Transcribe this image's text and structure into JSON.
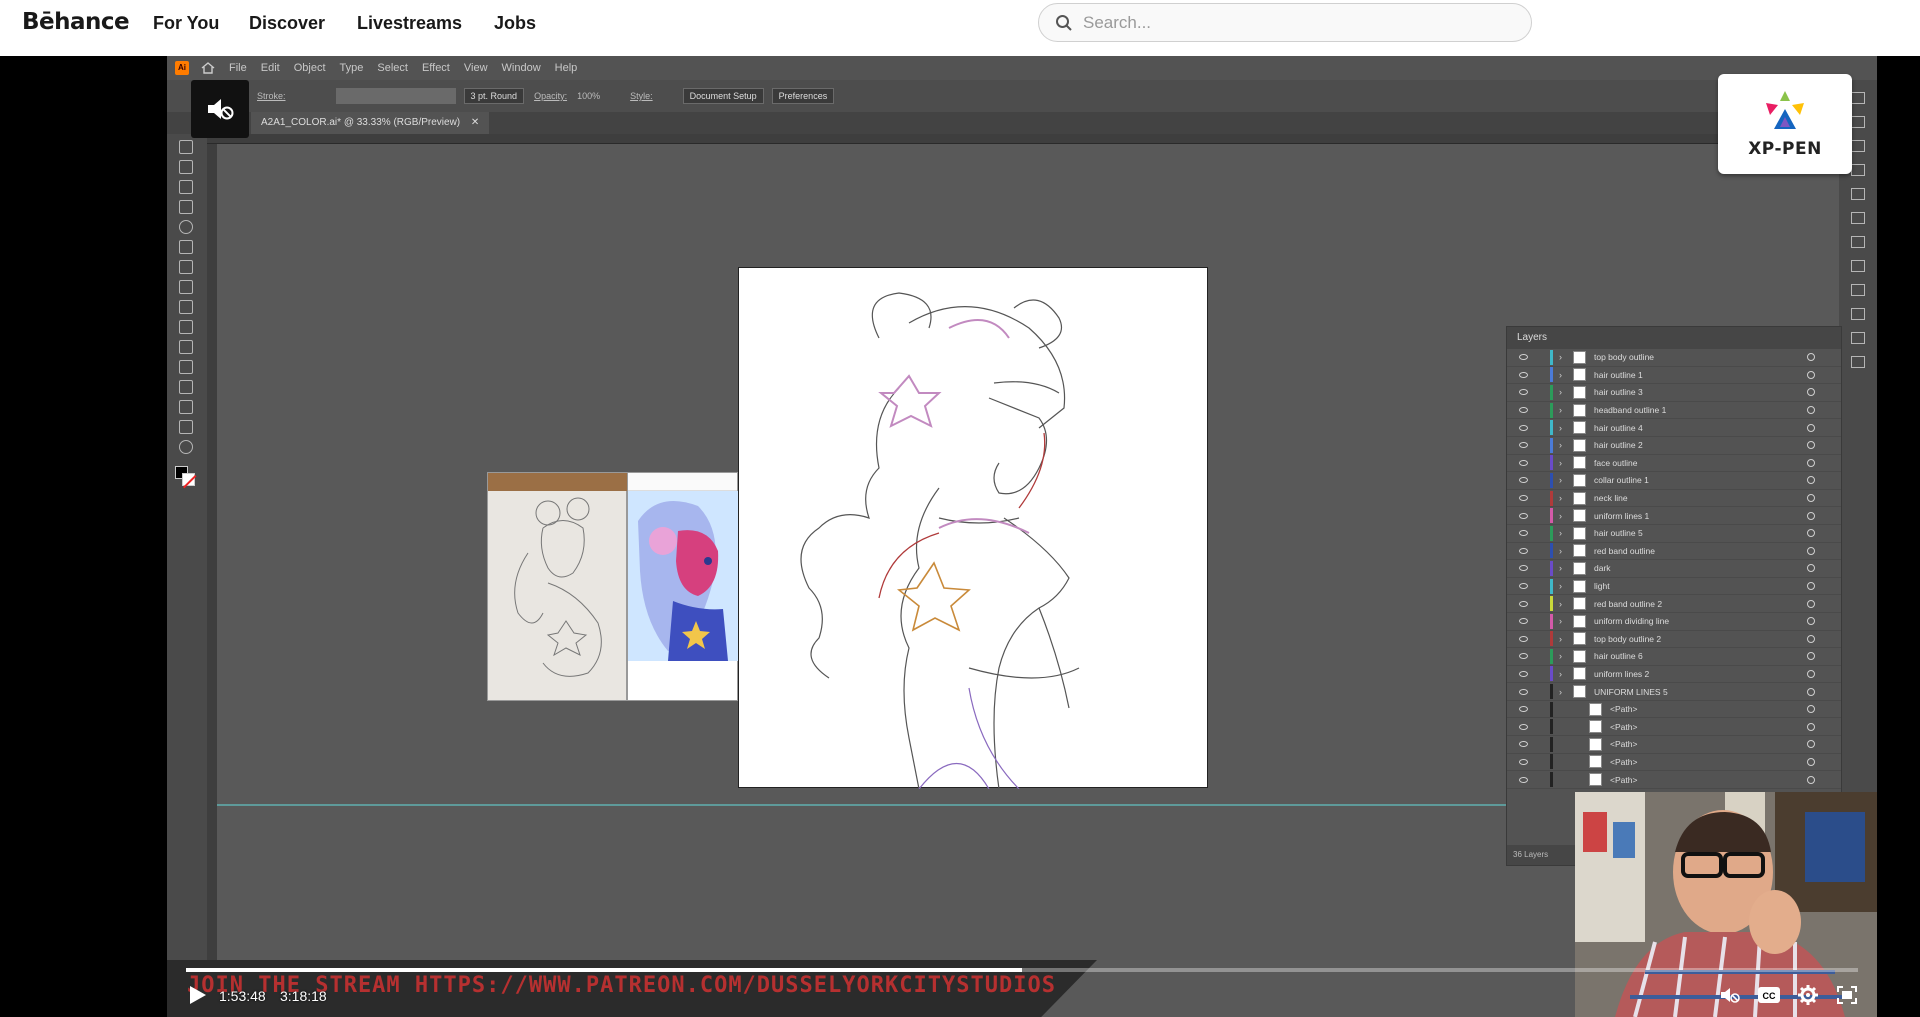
{
  "nav": {
    "logo": "Bēhance",
    "links": [
      "For You",
      "Discover",
      "Livestreams",
      "Jobs"
    ],
    "search_placeholder": "Search..."
  },
  "illustrator": {
    "menu": [
      "File",
      "Edit",
      "Object",
      "Type",
      "Select",
      "Effect",
      "View",
      "Window",
      "Help"
    ],
    "control_bar": {
      "stroke_label": "Stroke:",
      "brush": "3 pt. Round",
      "opacity_label": "Opacity:",
      "opacity_value": "100%",
      "style_label": "Style:",
      "document_setup": "Document Setup",
      "preferences": "Preferences"
    },
    "doc_tab": "A2A1_COLOR.ai* @ 33.33% (RGB/Preview)",
    "layers_panel": {
      "title": "Layers",
      "footer": "36 Layers",
      "layers": [
        {
          "name": "top body outline",
          "color": "#3fb8c9"
        },
        {
          "name": "hair outline 1",
          "color": "#4b7bd8"
        },
        {
          "name": "hair outline 3",
          "color": "#2c9b5a"
        },
        {
          "name": "headband outline 1",
          "color": "#2c9b5a"
        },
        {
          "name": "hair outline 4",
          "color": "#3fb8c9"
        },
        {
          "name": "hair outline 2",
          "color": "#4b7bd8"
        },
        {
          "name": "face outline",
          "color": "#6a4bc8"
        },
        {
          "name": "collar outline 1",
          "color": "#2d4fb0"
        },
        {
          "name": "neck line",
          "color": "#b03a3a"
        },
        {
          "name": "uniform lines 1",
          "color": "#d45aa8"
        },
        {
          "name": "hair outline 5",
          "color": "#2c9b5a"
        },
        {
          "name": "red band outline",
          "color": "#2d4fb0"
        },
        {
          "name": "dark",
          "color": "#6a4bc8"
        },
        {
          "name": "light",
          "color": "#3fb8c9"
        },
        {
          "name": "red band outline 2",
          "color": "#c8d83a"
        },
        {
          "name": "uniform dividing line",
          "color": "#d45aa8"
        },
        {
          "name": "top body outline 2",
          "color": "#b03a3a"
        },
        {
          "name": "hair outline 6",
          "color": "#2c9b5a"
        },
        {
          "name": "uniform lines 2",
          "color": "#6a4bc8"
        },
        {
          "name": "UNIFORM LINES 5",
          "color": "#222222"
        },
        {
          "name": "<Path>",
          "color": "#222222"
        },
        {
          "name": "<Path>",
          "color": "#222222"
        },
        {
          "name": "<Path>",
          "color": "#222222"
        },
        {
          "name": "<Path>",
          "color": "#222222"
        },
        {
          "name": "<Path>",
          "color": "#222222"
        }
      ]
    }
  },
  "sponsor": {
    "name": "XP-PEN"
  },
  "player": {
    "current_time": "1:53:48",
    "duration": "3:18:18",
    "progress": 0.5,
    "banner": "JOIN THE STREAM HTTPS://WWW.PATREON.COM/DUSSELYORKCITYSTUDIOS"
  }
}
